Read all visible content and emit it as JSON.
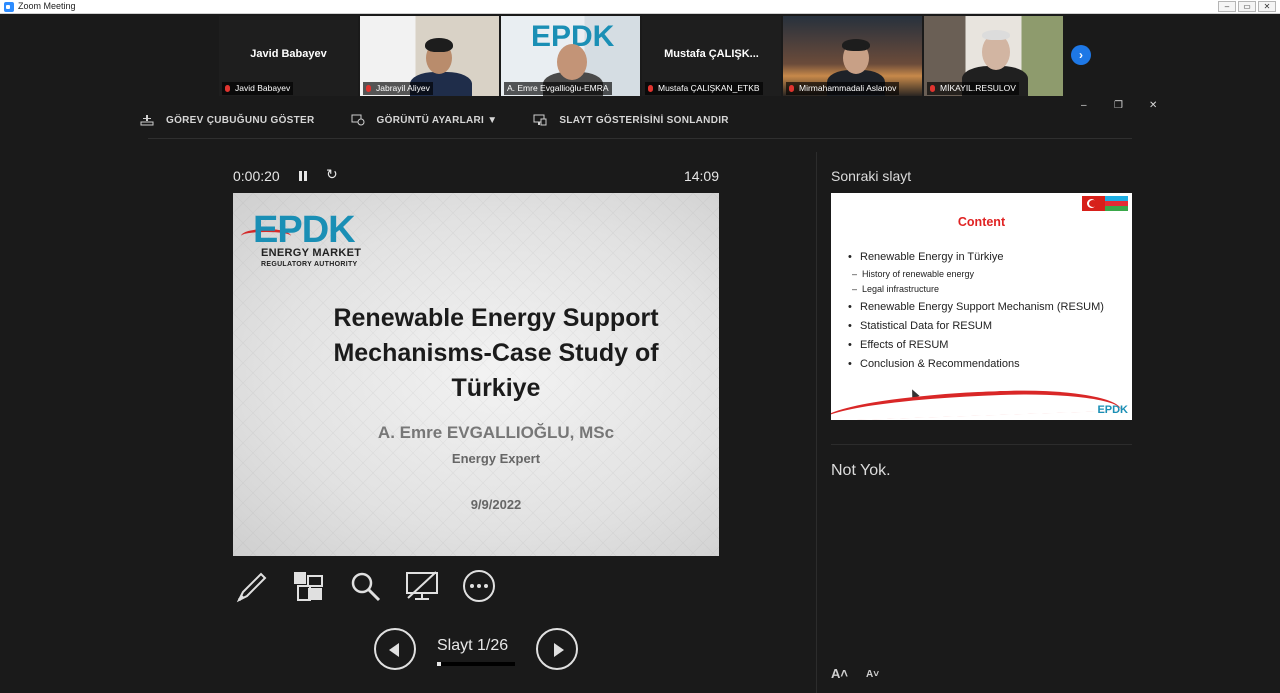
{
  "window": {
    "title": "Zoom Meeting",
    "controls": [
      "–",
      "▭",
      "✕"
    ]
  },
  "participants": [
    {
      "center_name": "Javid Babayev",
      "label": "Javid Babayev",
      "video": false
    },
    {
      "center_name": "",
      "label": "Jabrayil Aliyev",
      "video": true
    },
    {
      "center_name": "",
      "label": "A. Emre Evgallioğlu-EMRA",
      "video": true,
      "active": true
    },
    {
      "center_name": "Mustafa  ÇALIŞK...",
      "label": "Mustafa ÇALIŞKAN_ETKB",
      "video": false
    },
    {
      "center_name": "",
      "label": "Mirmahammadali Aslanov",
      "video": true
    },
    {
      "center_name": "",
      "label": "MİKAYIL.RESULOV",
      "video": true
    }
  ],
  "share_controls": {
    "minimize": "–",
    "restore": "❐",
    "close": "✕"
  },
  "presenter_toolbar": {
    "taskbar": "GÖREV ÇUBUĞUNU GÖSTER",
    "display_settings": "GÖRÜNTÜ AYARLARI ▼",
    "end_slideshow": "SLAYT GÖSTERİSİNİ SONLANDIR"
  },
  "timer": {
    "elapsed": "0:00:20",
    "clock": "14:09",
    "reset_glyph": "↻"
  },
  "current_slide": {
    "logo_text": "EPDK",
    "logo_line1": "ENERGY MARKET",
    "logo_line2": "REGULATORY AUTHORITY",
    "title_line1": "Renewable Energy Support",
    "title_line2": "Mechanisms-Case Study of",
    "title_line3": "Türkiye",
    "author": "A. Emre EVGALLIOĞLU, MSc",
    "role": "Energy Expert",
    "date": "9/9/2022"
  },
  "navigation": {
    "slide_counter": "Slayt 1/26",
    "progress_fraction": 0.038
  },
  "next_slide_panel": {
    "label": "Sonraki slayt",
    "title": "Content",
    "bullets": [
      "Renewable Energy in Türkiye",
      "History of renewable energy",
      "Legal infrastructure",
      "Renewable Energy Support Mechanism (RESUM)",
      "Statistical Data for RESUM",
      "Effects of RESUM",
      "Conclusion & Recommendations"
    ],
    "mini_logo": "EPDK"
  },
  "notes": {
    "text": "Not Yok."
  },
  "font_buttons": {
    "increase": "A˄",
    "decrease": "A˅"
  },
  "colors": {
    "accent_blue": "#1e78e6",
    "active_speaker": "#9ac62b",
    "content_red": "#e02323",
    "epdk_blue": "#1a8fb5"
  }
}
